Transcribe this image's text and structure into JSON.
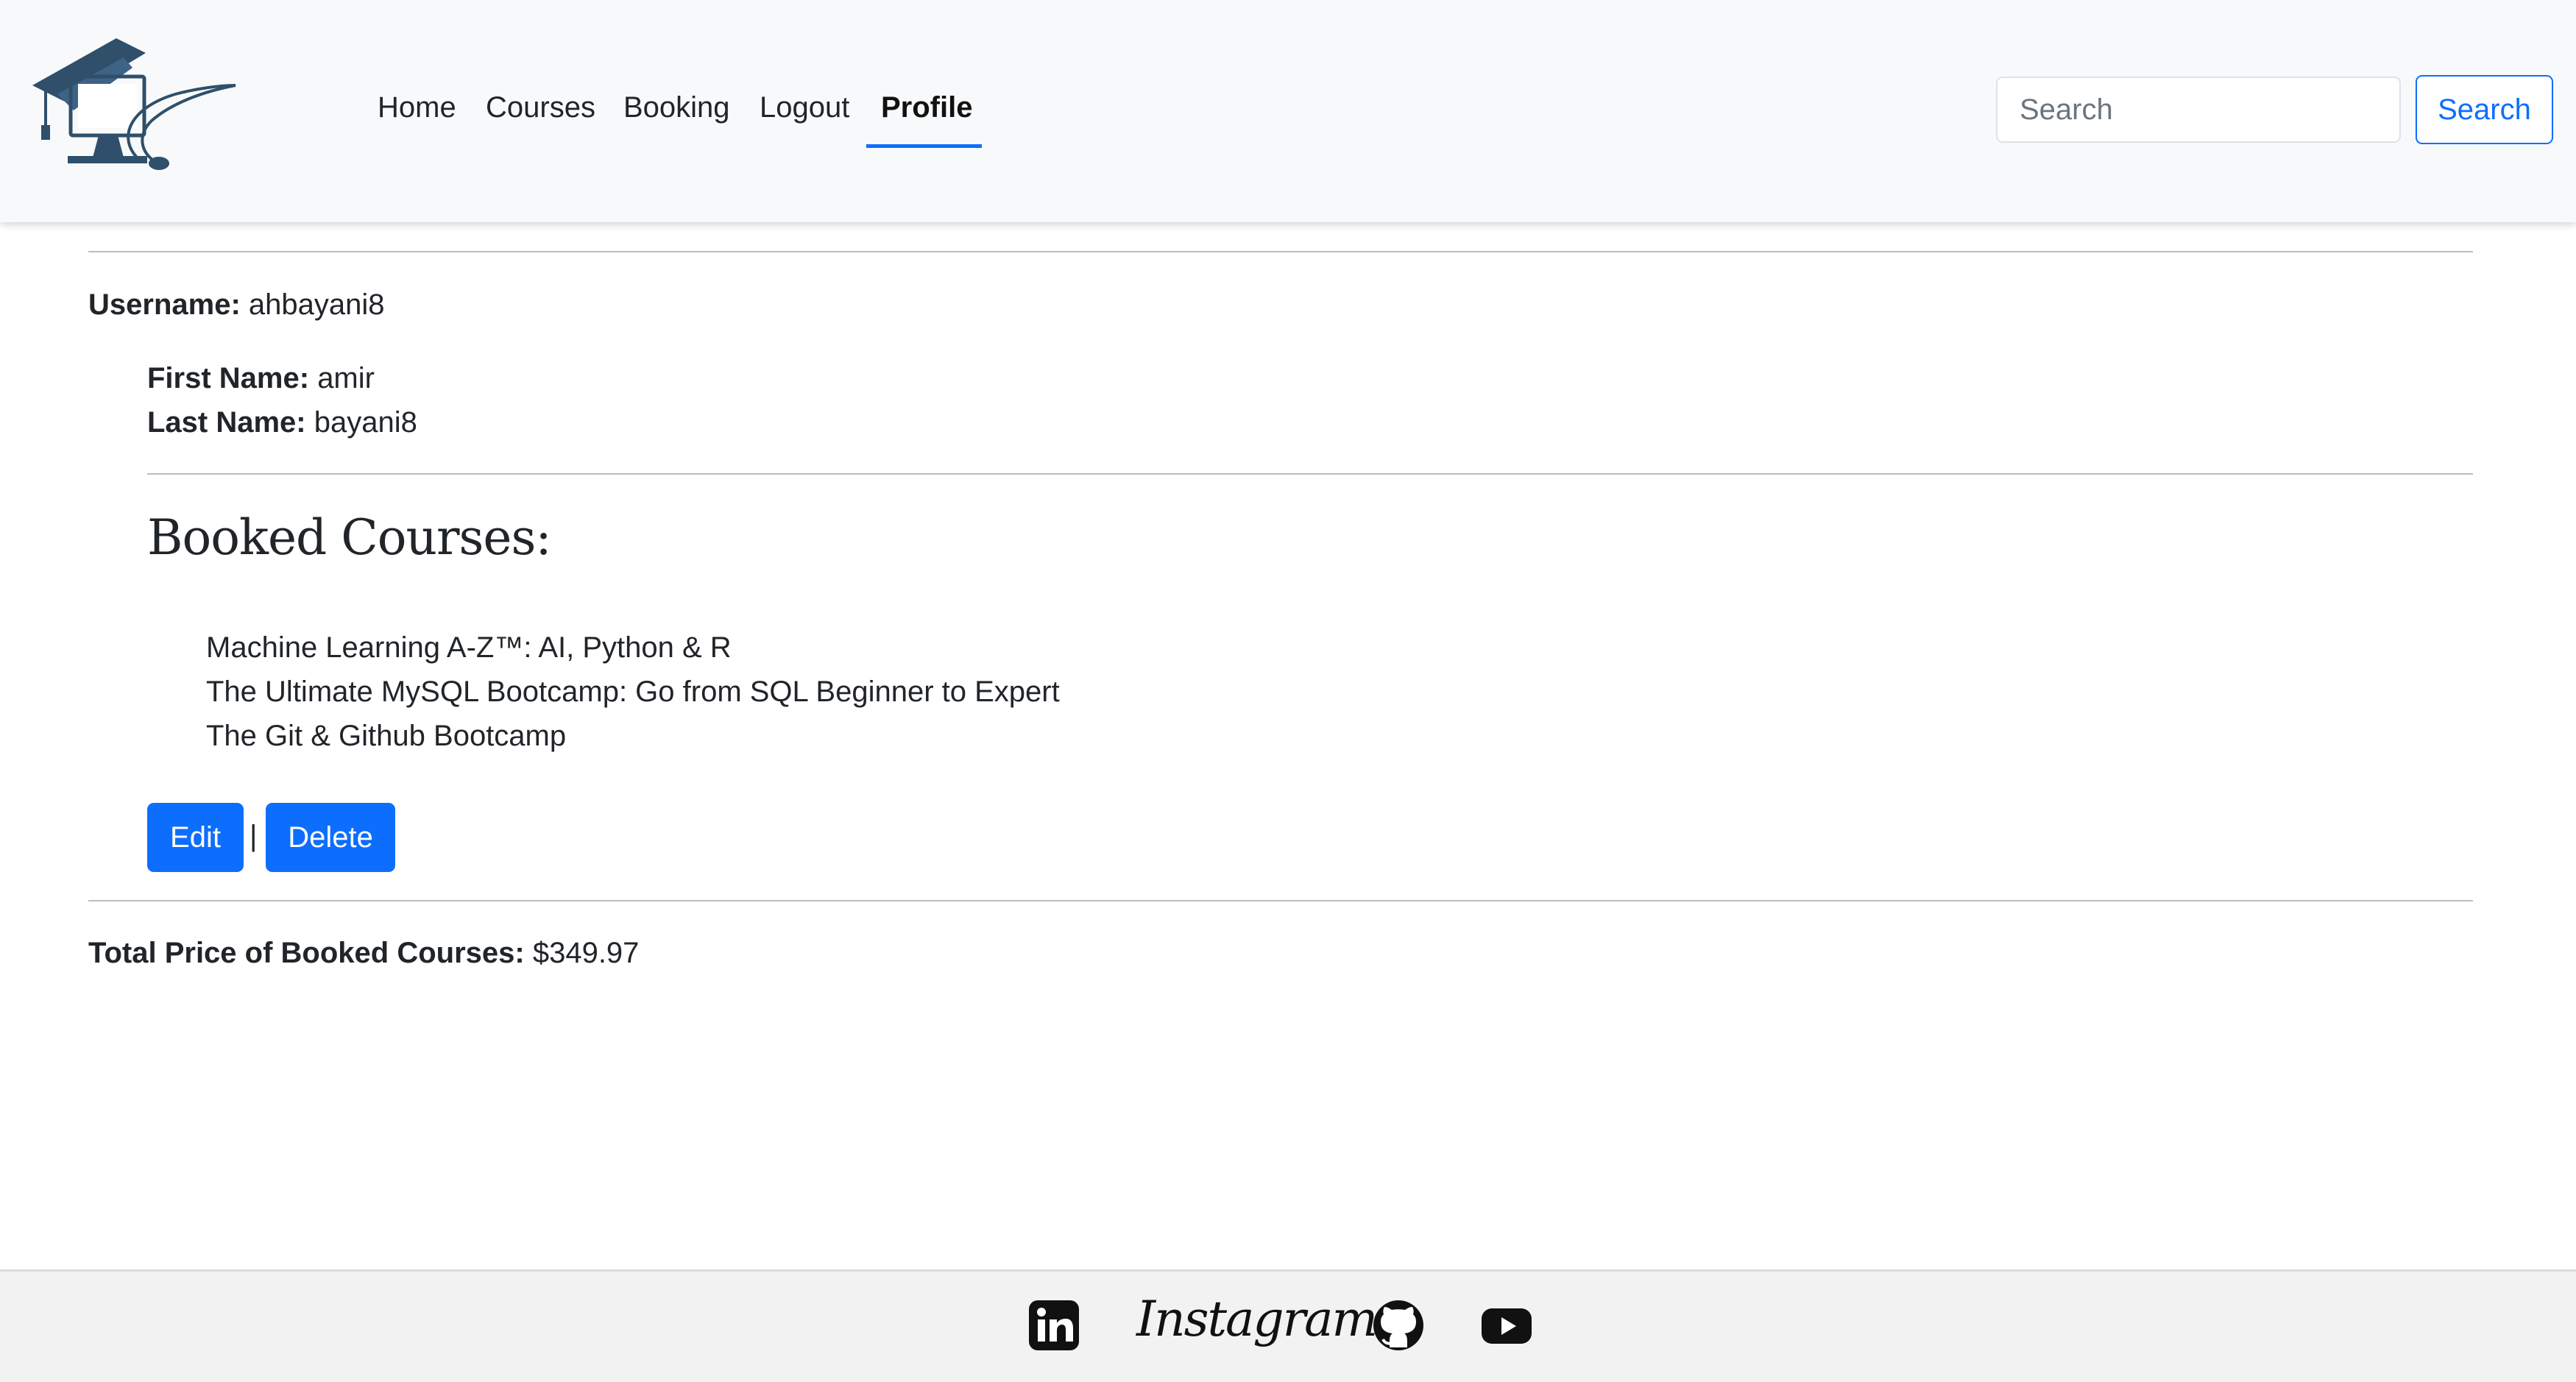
{
  "navbar": {
    "links": [
      {
        "label": "Home"
      },
      {
        "label": "Courses"
      },
      {
        "label": "Booking"
      },
      {
        "label": "Logout"
      },
      {
        "label": "Profile",
        "active": true
      }
    ],
    "search": {
      "placeholder": "Search",
      "button_label": "Search"
    }
  },
  "profile": {
    "username_label": "Username:",
    "username": "ahbayani8",
    "first_name_label": "First Name:",
    "first_name": "amir",
    "last_name_label": "Last Name:",
    "last_name": "bayani8",
    "booked_title": "Booked Courses:",
    "courses": [
      "Machine Learning A-Z™: AI, Python & R",
      "The Ultimate MySQL Bootcamp: Go from SQL Beginner to Expert",
      "The Git & Github Bootcamp"
    ],
    "edit_label": "Edit",
    "separator": "|",
    "delete_label": "Delete",
    "total_label": "Total Price of Booked Courses:",
    "total_value": "$349.97"
  },
  "footer": {
    "instagram_text": "Instagram",
    "icons": [
      "linkedin-icon",
      "instagram-icon",
      "github-icon",
      "youtube-icon"
    ]
  },
  "colors": {
    "accent": "#0d6efd",
    "navbar_bg": "#f8f9fa",
    "footer_bg": "#f2f2f2",
    "logo": "#2f4f6a"
  }
}
